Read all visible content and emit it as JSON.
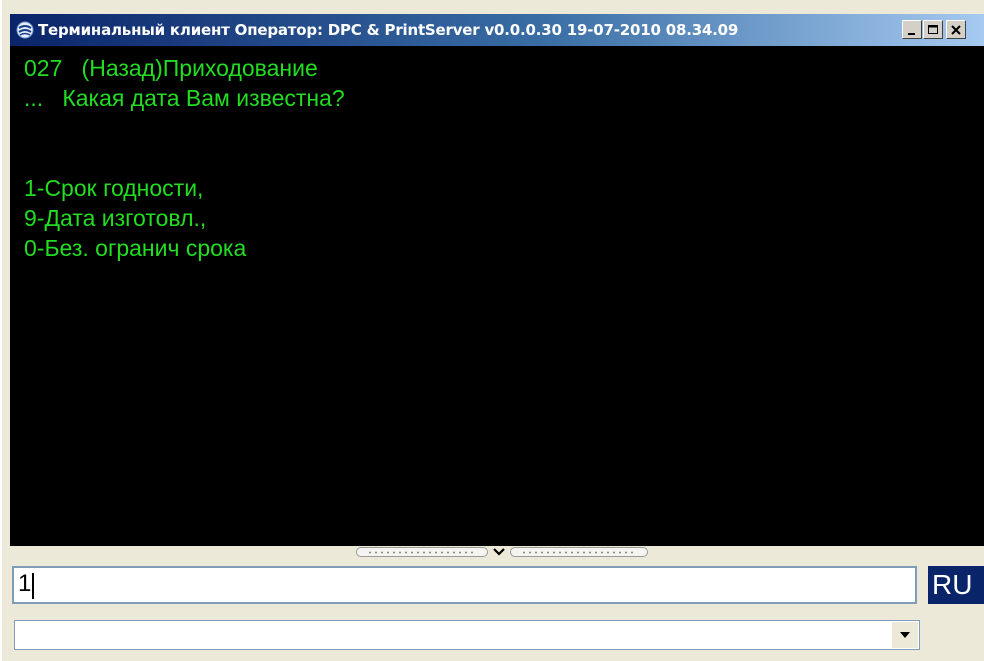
{
  "window": {
    "title": "Терминальный клиент Оператор: DPC & PrintServer v0.0.0.30 19-07-2010 08.34.09",
    "icon": "app-terminal-icon"
  },
  "controls": {
    "minimize": "minimize-icon",
    "maximize": "maximize-icon",
    "close": "close-icon"
  },
  "terminal": {
    "lines": [
      "027   (Назад)Приходование",
      "...   Какая дата Вам известна?",
      "",
      "",
      "1-Срок годности,",
      "9-Дата изготовл.,",
      "0-Без. огранич срока"
    ],
    "text_color": "#22dd22",
    "background": "#000000"
  },
  "input": {
    "value": "1"
  },
  "language_indicator": "RU",
  "history_combo": {
    "value": ""
  },
  "colors": {
    "titlebar_start": "#0a246a",
    "titlebar_end": "#a6caf0",
    "window_bg": "#ece9d8",
    "lang_bg": "#0a246a"
  }
}
